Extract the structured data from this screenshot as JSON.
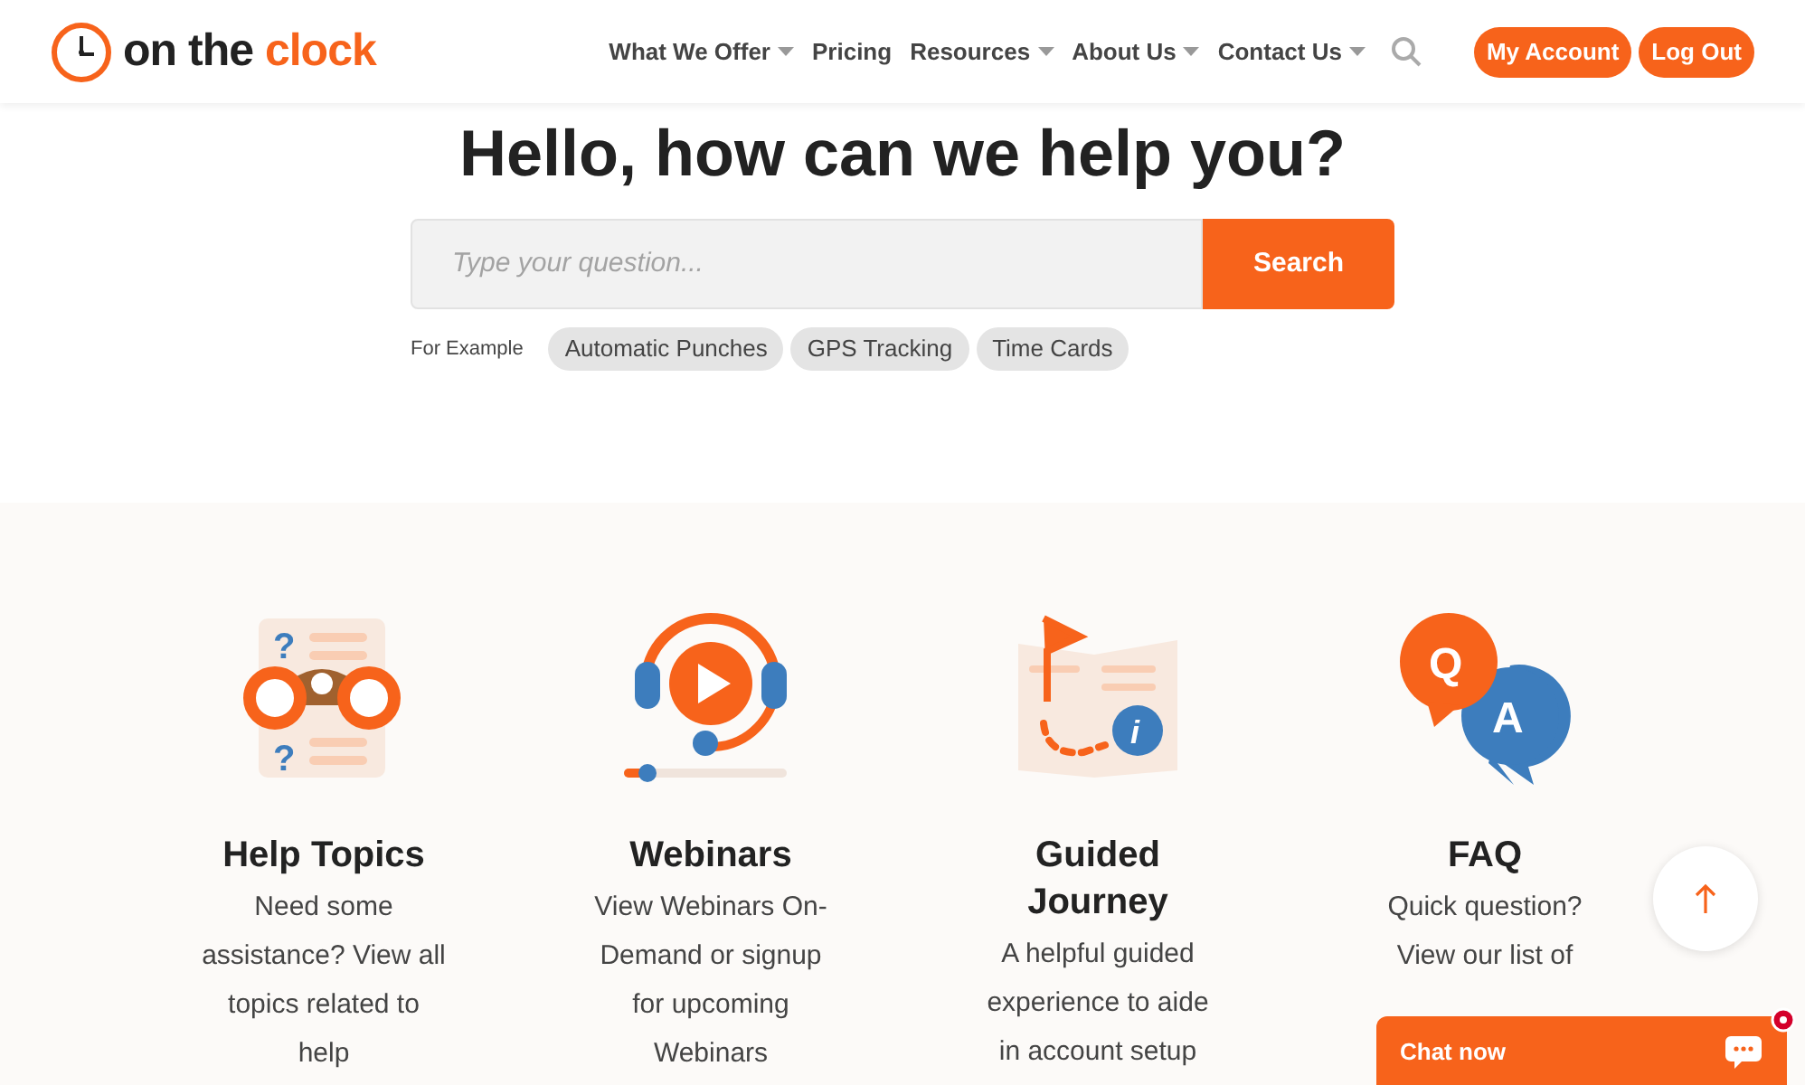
{
  "logo": {
    "dark": "on the",
    "accent": "clock"
  },
  "nav": [
    {
      "label": "What We Offer",
      "dropdown": true
    },
    {
      "label": "Pricing",
      "dropdown": false
    },
    {
      "label": "Resources",
      "dropdown": true
    },
    {
      "label": "About Us",
      "dropdown": true
    },
    {
      "label": "Contact Us",
      "dropdown": true
    }
  ],
  "account_buttons": [
    "My Account",
    "Log Out"
  ],
  "hero": {
    "title": "Hello, how can we help you?",
    "search": {
      "placeholder": "Type your question...",
      "button": "Search"
    },
    "examples_label": "For Example",
    "examples": [
      "Automatic Punches",
      "GPS Tracking",
      "Time Cards"
    ]
  },
  "cards": [
    {
      "kind": "help",
      "icon_marks": [
        "?",
        "?"
      ],
      "title": "Help Topics",
      "lines": [
        "Need some",
        "assistance? View all",
        "topics related to",
        "help"
      ]
    },
    {
      "kind": "webinar",
      "title": "Webinars",
      "lines": [
        "View Webinars On-",
        "Demand or signup",
        "for upcoming",
        "Webinars"
      ]
    },
    {
      "kind": "journey",
      "icon_marks": [
        "i"
      ],
      "title": "Guided Journey",
      "lines": [
        "A helpful guided",
        "experience to aide",
        "in account setup"
      ]
    },
    {
      "kind": "faq",
      "icon_marks": [
        "Q",
        "A"
      ],
      "title": "FAQ",
      "lines": [
        "Quick question?",
        "View our list of"
      ]
    }
  ],
  "chat": {
    "label": "Chat now"
  }
}
